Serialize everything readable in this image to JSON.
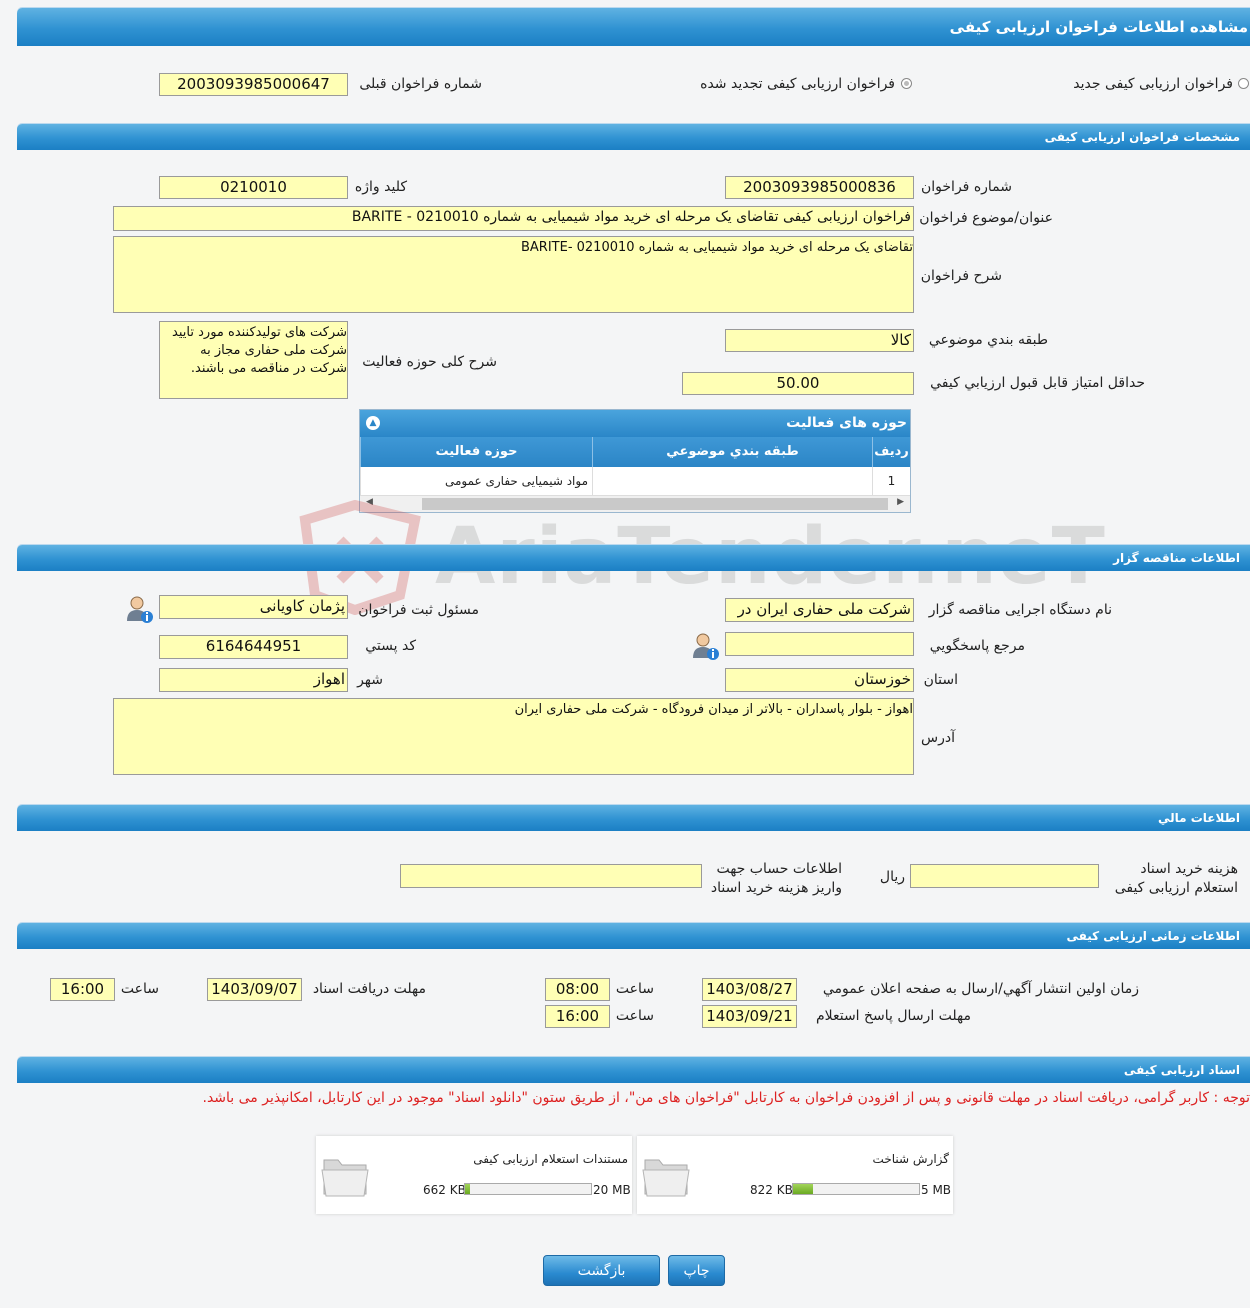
{
  "page": {
    "title": "مشاهده اطلاعات فراخوان ارزیابی کیفی"
  },
  "type_section": {
    "new_label": "فراخوان ارزیابی کیفی جدید",
    "renewed_label": "فراخوان ارزیابی کیفی تجدید شده",
    "prev_number_label": "شماره فراخوان قبلی",
    "prev_number": "2003093985000647"
  },
  "spec_section": {
    "header": "مشخصات فراخوان ارزیابی کیفی",
    "number_label": "شماره فراخوان",
    "number": "2003093985000836",
    "keyword_label": "کلید واژه",
    "keyword": "0210010",
    "subject_label": "عنوان/موضوع فراخوان",
    "subject": "فراخوان ارزیابی کیفی تقاضای یک مرحله ای خرید مواد شیمیایی به شماره 0210010 - BARITE",
    "description_label": "شرح فراخوان",
    "description": "تقاضای یک مرحله ای خرید مواد شیمیایی به شماره 0210010 -BARITE",
    "category_label": "طبقه بندي موضوعي",
    "category": "کالا",
    "activity_scope_label": "شرح کلی حوزه فعالیت",
    "activity_scope": "شرکت های تولیدکننده مورد تایید شرکت ملی حفاری مجاز به شرکت در مناقصه می باشند.",
    "min_score_label": "حداقل امتياز قابل قبول ارزيابي کيفي",
    "min_score": "50.00"
  },
  "activity_grid": {
    "title": "حوزه های فعالیت",
    "columns": [
      "ردیف",
      "طبقه بندي موضوعي",
      "حوزه فعالیت"
    ],
    "rows": [
      {
        "index": "1",
        "category": "",
        "activity": "مواد شیمیایی حفاری عمومی"
      }
    ]
  },
  "watermark": {
    "text": "AriaTender.neT"
  },
  "organizer_section": {
    "header": "اطلاعات مناقصه گزار",
    "org_label": "نام دستگاه اجرایی مناقصه گزار",
    "org": "شرکت ملی حفاری ایران در",
    "responsible_label": "مسئول ثبت فراخوان",
    "responsible": "پژمان کاویانی",
    "reference_label": "مرجع پاسخگويي",
    "reference": "",
    "postal_label": "کد پستي",
    "postal": "6164644951",
    "province_label": "استان",
    "province": "خوزستان",
    "city_label": "شهر",
    "city": "اهواز",
    "address_label": "آدرس",
    "address": "اهواز - بلوار پاسداران - بالاتر از میدان فرودگاه - شرکت ملی حفاری ایران"
  },
  "financial_section": {
    "header": "اطلاعات مالي",
    "fee_label_1": "هزینه خرید اسناد",
    "fee_label_2": "استعلام ارزیابی کیفی",
    "fee": "",
    "currency": "ریال",
    "account_label_1": "اطلاعات حساب جهت",
    "account_label_2": "واریز هزینه خرید اسناد",
    "account": ""
  },
  "time_section": {
    "header": "اطلاعات زمانی ارزیابی کیفی",
    "publish_label": "زمان اولین انتشار آگهي/ارسال به صفحه اعلان عمومي",
    "publish_date": "1403/08/27",
    "time_label": "ساعت",
    "publish_time": "08:00",
    "receive_label": "مهلت دریافت اسناد",
    "receive_date": "1403/09/07",
    "receive_time": "16:00",
    "response_label": "مهلت ارسال پاسخ استعلام",
    "response_date": "1403/09/21",
    "response_time": "16:00"
  },
  "documents_section": {
    "header": "اسناد ارزیابی کیفی",
    "notice": "توجه : کاربر گرامی، دریافت اسناد در مهلت قانونی و پس از افزودن فراخوان به کارتابل \"فراخوان های من\"، از طریق ستون \"دانلود اسناد\" موجود در این کارتابل، امکانپذیر می باشد.",
    "files": [
      {
        "name": "گزارش شناخت",
        "size": "822 KB",
        "max": "5 MB",
        "usage": 0.16
      },
      {
        "name": "مستندات استعلام ارزیابی کیفی",
        "size": "662 KB",
        "max": "20 MB",
        "usage": 0.04
      }
    ]
  },
  "buttons": {
    "print": "چاپ",
    "back": "بازگشت"
  }
}
